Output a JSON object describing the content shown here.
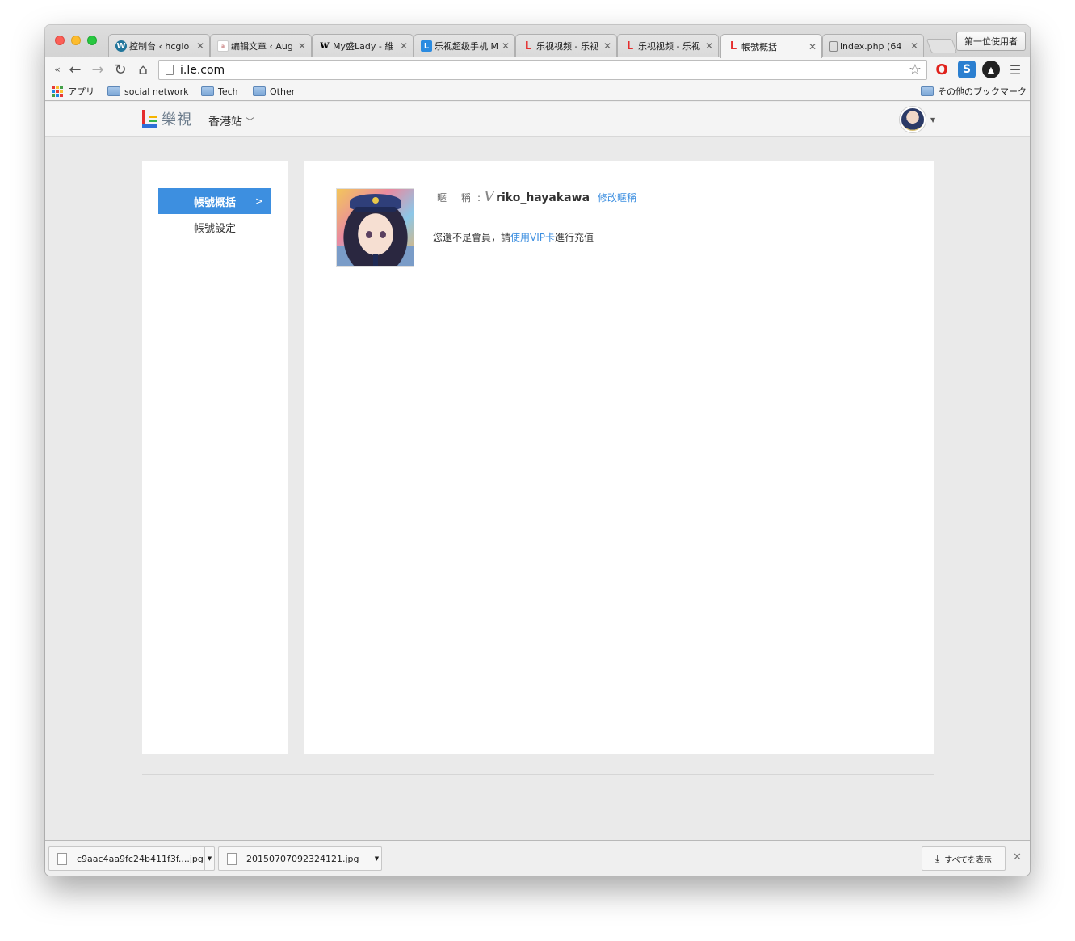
{
  "browser": {
    "tabs": [
      {
        "title": "控制台 ‹ hcgio",
        "icon": "wordpress-icon",
        "active": false
      },
      {
        "title": "编辑文章 ‹ Aug",
        "icon": "site-favicon",
        "active": false
      },
      {
        "title": "My盛Lady - 維",
        "icon": "wikipedia-icon",
        "active": false
      },
      {
        "title": "乐视超级手机 M",
        "icon": "letv-blue-icon",
        "active": false
      },
      {
        "title": "乐视视频 - 乐视",
        "icon": "letv-icon",
        "active": false
      },
      {
        "title": "乐视视频 - 乐视",
        "icon": "letv-icon",
        "active": false
      },
      {
        "title": "帳號概括",
        "icon": "letv-icon",
        "active": true
      },
      {
        "title": "index.php (64",
        "icon": "page-icon",
        "active": false
      }
    ],
    "profile_button": "第一位使用者",
    "url": "i.le.com",
    "bookmarks": {
      "apps": "アプリ",
      "items": [
        "social network",
        "Tech",
        "Other"
      ],
      "other_bookmarks": "その他のブックマーク"
    }
  },
  "site": {
    "logo_text": "樂視",
    "region": "香港站",
    "sidebar": {
      "items": [
        {
          "label": "帳號概括",
          "active": true
        },
        {
          "label": "帳號設定",
          "active": false
        }
      ]
    },
    "profile": {
      "nickname_label": "暱稱",
      "nickname_colon": ":",
      "vip_glyph": "V",
      "nickname": "riko_hayakawa",
      "edit_link": "修改暱稱",
      "member_prefix": "您還不是會員，請",
      "member_link": "使用VIP卡",
      "member_suffix": "進行充值"
    }
  },
  "downloads": {
    "items": [
      "c9aac4aa9fc24b411f3f....jpg",
      "20150707092324121.jpg"
    ],
    "show_all": "すべてを表示"
  },
  "colors": {
    "accent": "#3d8fe0",
    "page_bg": "#eaeaea",
    "logo_red": "#e52d2d"
  }
}
